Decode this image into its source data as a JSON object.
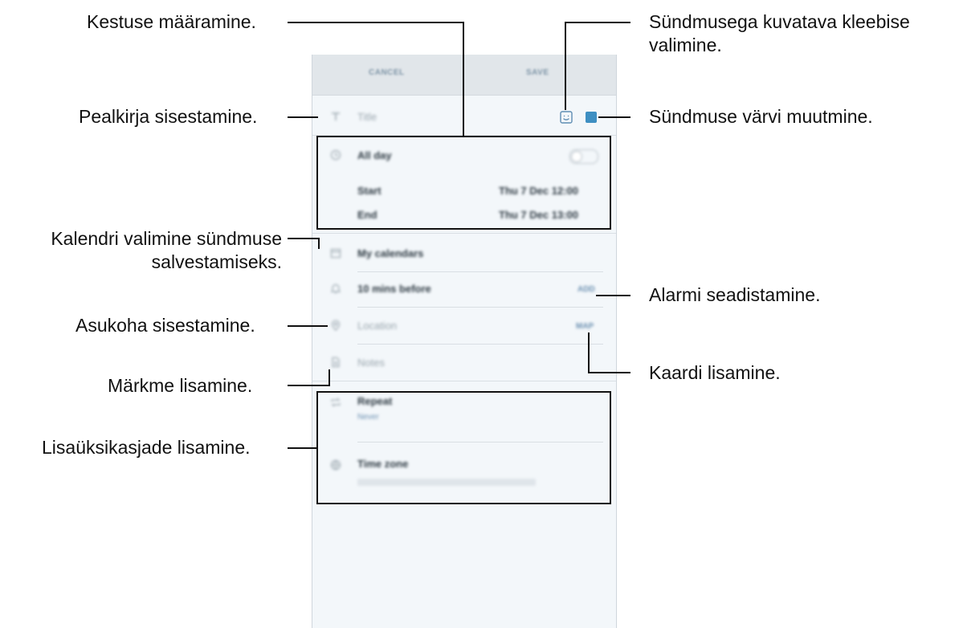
{
  "screen": {
    "topbar": {
      "cancel": "CANCEL",
      "save": "SAVE"
    },
    "title_placeholder": "Title",
    "all_day": "All day",
    "start_label": "Start",
    "start_value": "Thu 7 Dec   12:00",
    "end_label": "End",
    "end_value": "Thu 7 Dec   13:00",
    "calendar": "My calendars",
    "alarm": "10 mins before",
    "alarm_action": "ADD",
    "location_placeholder": "Location",
    "map_action": "MAP",
    "notes_placeholder": "Notes",
    "repeat": "Repeat",
    "repeat_value": "Never",
    "time_zone": "Time zone",
    "event_color": "#3e8fc2"
  },
  "callouts": {
    "duration": "Kestuse määramine.",
    "title": "Pealkirja sisestamine.",
    "calendar_line1": "Kalendri valimine sündmuse",
    "calendar_line2": "salvestamiseks.",
    "location": "Asukoha sisestamine.",
    "notes": "Märkme lisamine.",
    "extra": "Lisaüksikasjade lisamine.",
    "sticker_line1": "Sündmusega kuvatava kleebise",
    "sticker_line2": "valimine.",
    "color": "Sündmuse värvi muutmine.",
    "alarm": "Alarmi seadistamine.",
    "map": "Kaardi lisamine."
  }
}
